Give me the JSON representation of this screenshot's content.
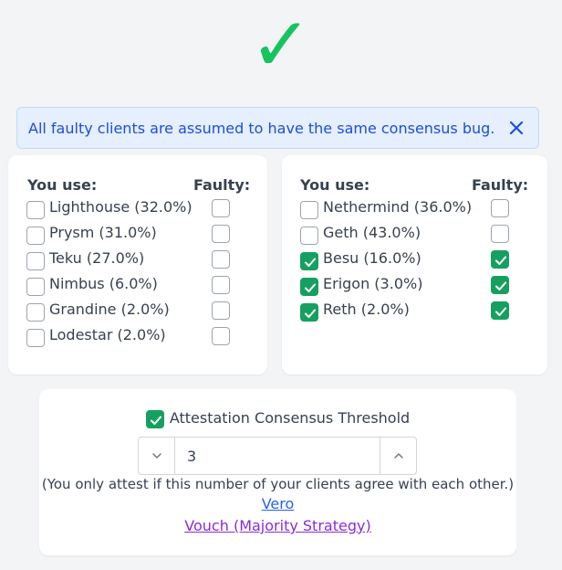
{
  "status": {
    "check_glyph": "✓",
    "color": "#16c35e"
  },
  "alert": {
    "text": "All faulty clients are assumed to have the same consensus bug.",
    "close_icon": "close-icon"
  },
  "consensus_clients": {
    "you_use_header": "You use:",
    "faulty_header": "Faulty:",
    "items": [
      {
        "label": "Lighthouse (32.0%)",
        "use": false,
        "faulty": false
      },
      {
        "label": "Prysm (31.0%)",
        "use": false,
        "faulty": false
      },
      {
        "label": "Teku (27.0%)",
        "use": false,
        "faulty": false
      },
      {
        "label": "Nimbus (6.0%)",
        "use": false,
        "faulty": false
      },
      {
        "label": "Grandine (2.0%)",
        "use": false,
        "faulty": false
      },
      {
        "label": "Lodestar (2.0%)",
        "use": false,
        "faulty": false
      }
    ]
  },
  "execution_clients": {
    "you_use_header": "You use:",
    "faulty_header": "Faulty:",
    "items": [
      {
        "label": "Nethermind (36.0%)",
        "use": false,
        "faulty": false
      },
      {
        "label": "Geth (43.0%)",
        "use": false,
        "faulty": false
      },
      {
        "label": "Besu (16.0%)",
        "use": true,
        "faulty": true
      },
      {
        "label": "Erigon (3.0%)",
        "use": true,
        "faulty": true
      },
      {
        "label": "Reth (2.0%)",
        "use": true,
        "faulty": true
      }
    ]
  },
  "threshold": {
    "label": "Attestation Consensus Threshold",
    "enabled": true,
    "value": "3",
    "hint": "(You only attest if this number of your clients agree with each other.)"
  },
  "links": {
    "vero": "Vero",
    "vouch": "Vouch (Majority Strategy)"
  },
  "colors": {
    "checked": "#16a060",
    "alert_text": "#1d4ed8",
    "link_blue": "#2563eb",
    "link_purple": "#8a2bd8"
  }
}
